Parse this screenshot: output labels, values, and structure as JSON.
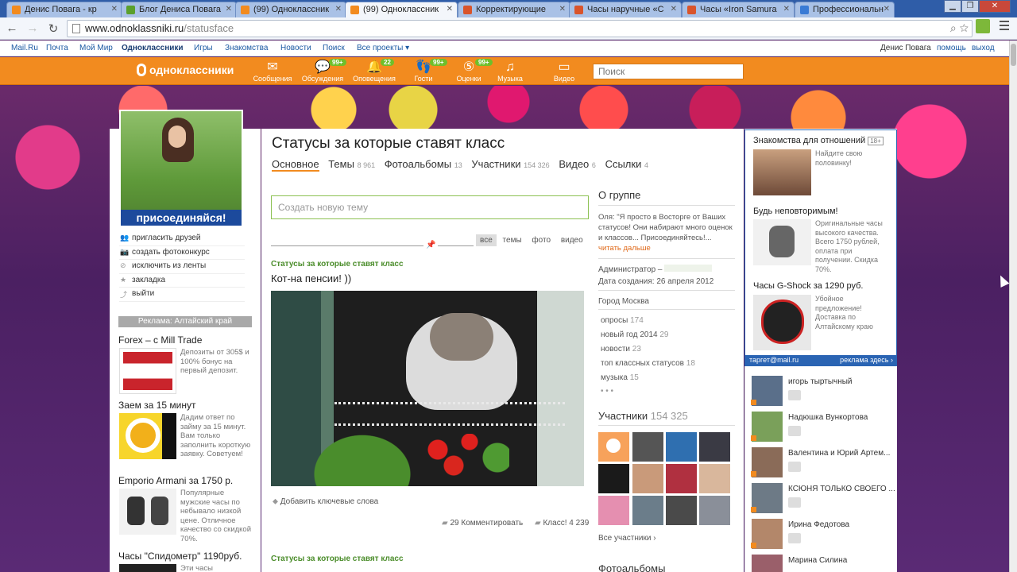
{
  "browser": {
    "tabs": [
      {
        "title": "Денис Повага - кр",
        "color": "#f28b1f"
      },
      {
        "title": "Блог Дениса Повага",
        "color": "#5aa02c"
      },
      {
        "title": "(99) Одноклассник",
        "color": "#f28b1f"
      },
      {
        "title": "(99) Одноклассник",
        "color": "#f28b1f"
      },
      {
        "title": "Корректирующие",
        "color": "#d9542b"
      },
      {
        "title": "Часы наручные «С",
        "color": "#d9542b"
      },
      {
        "title": "Часы «Iron Samura",
        "color": "#d9542b"
      },
      {
        "title": "Профессиональн",
        "color": "#3a7bd5"
      }
    ],
    "url_host": "www.odnoklassniki.ru",
    "url_path": "/statusface"
  },
  "mailbar": {
    "items": [
      "Mail.Ru",
      "Почта",
      "Мой Мир",
      "Одноклассники",
      "Игры",
      "Знакомства",
      "Новости",
      "Поиск",
      "Все проекты ▾"
    ],
    "user": "Денис Повага",
    "help": "помощь",
    "logout": "выход"
  },
  "header": {
    "logo": "одноклассники",
    "nav": [
      {
        "label": "Сообщения",
        "icon": "✉",
        "badge": ""
      },
      {
        "label": "Обсуждения",
        "icon": "💬",
        "badge": "99+"
      },
      {
        "label": "Оповещения",
        "icon": "🔔",
        "badge": "22"
      },
      {
        "label": "Гости",
        "icon": "👣",
        "badge": "99+"
      },
      {
        "label": "Оценки",
        "icon": "⑤",
        "badge": "99+"
      },
      {
        "label": "Музыка",
        "icon": "♫",
        "badge": ""
      },
      {
        "label": "Видео",
        "icon": "▭",
        "badge": ""
      }
    ],
    "search_placeholder": "Поиск"
  },
  "left": {
    "join_label": "присоединяйся!",
    "actions": [
      {
        "label": "пригласить друзей",
        "icon": "👥"
      },
      {
        "label": "создать фотоконкурс",
        "icon": "📷"
      },
      {
        "label": "исключить из ленты",
        "icon": "⊘"
      },
      {
        "label": "закладка",
        "icon": "★"
      },
      {
        "label": "выйти",
        "icon": "⤴"
      }
    ],
    "ads_header": "Реклама: Алтайский край",
    "ads": [
      {
        "title": "Forex – с Mill Trade",
        "text": "Депозиты от 305$ и 100% бонус на первый депозит."
      },
      {
        "title": "Заем за 15 минут",
        "text": "Дадим ответ по займу за 15 минут. Вам только заполнить короткую заявку. Советуем!"
      },
      {
        "title": "Emporio Armani за 1750 р.",
        "text": "Популярные мужские часы по небывало низкой цене. Отличное качество со скидкой 70%."
      },
      {
        "title": "Часы \"Спидометр\" 1190руб.",
        "text": "Эти часы"
      }
    ]
  },
  "main": {
    "title": "Статусы за которые ставят класс",
    "tabs": [
      {
        "label": "Основное",
        "count": ""
      },
      {
        "label": "Темы",
        "count": "8 961"
      },
      {
        "label": "Фотоальбомы",
        "count": "13"
      },
      {
        "label": "Участники",
        "count": "154 326"
      },
      {
        "label": "Видео",
        "count": "6"
      },
      {
        "label": "Ссылки",
        "count": "4"
      }
    ],
    "new_topic_placeholder": "Создать новую тему",
    "filters": [
      "все",
      "темы",
      "фото",
      "видео"
    ],
    "post": {
      "group": "Статусы за которые ставят класс",
      "text": "Кот-на пенсии! ))",
      "keywords": "Добавить ключевые слова",
      "comments": "29 Комментировать",
      "likes": "Класс! 4 239"
    },
    "post2_group": "Статусы за которые ставят класс"
  },
  "about": {
    "title": "О группе",
    "text": "Оля: \"Я просто в Восторге от Ваших статусов! Они набирают много оценок и классов... Присоединяйтесь!...",
    "more": "читать дальше",
    "admin": "Администратор –",
    "created": "Дата создания: 26 апреля 2012",
    "city": "Город Москва",
    "categories": [
      {
        "name": "опросы",
        "count": "174"
      },
      {
        "name": "новый год 2014",
        "count": "29"
      },
      {
        "name": "новости",
        "count": "23"
      },
      {
        "name": "топ классных статусов",
        "count": "18"
      },
      {
        "name": "музыка",
        "count": "15"
      }
    ],
    "more_dots": "• • •",
    "members_title": "Участники",
    "members_count": "154 325",
    "all_members": "Все участники ›",
    "photos_title": "Фотоальбомы"
  },
  "right": {
    "ads": [
      {
        "title": "Знакомства для отношений",
        "age": "18+",
        "text": "Найдите свою половинку!"
      },
      {
        "title": "Будь неповторимым!",
        "age": "",
        "text": "Оригинальные часы высокого качества. Всего 1750 рублей, оплата при получении. Скидка 70%."
      },
      {
        "title": "Часы G-Shock за 1290 руб.",
        "age": "",
        "text": "Убойное предложение! Доставка по Алтайскому краю"
      }
    ],
    "target_left": "таргет@mail.ru",
    "target_right": "реклама здесь ›",
    "friends": [
      "игорь тыртычный",
      "Надюшка Вункортова",
      "Валентина и Юрий Артем...",
      "КСЮНЯ ТОЛЬКО СВОЕГО ...",
      "Ирина Федотова",
      "Марина Силина"
    ]
  }
}
